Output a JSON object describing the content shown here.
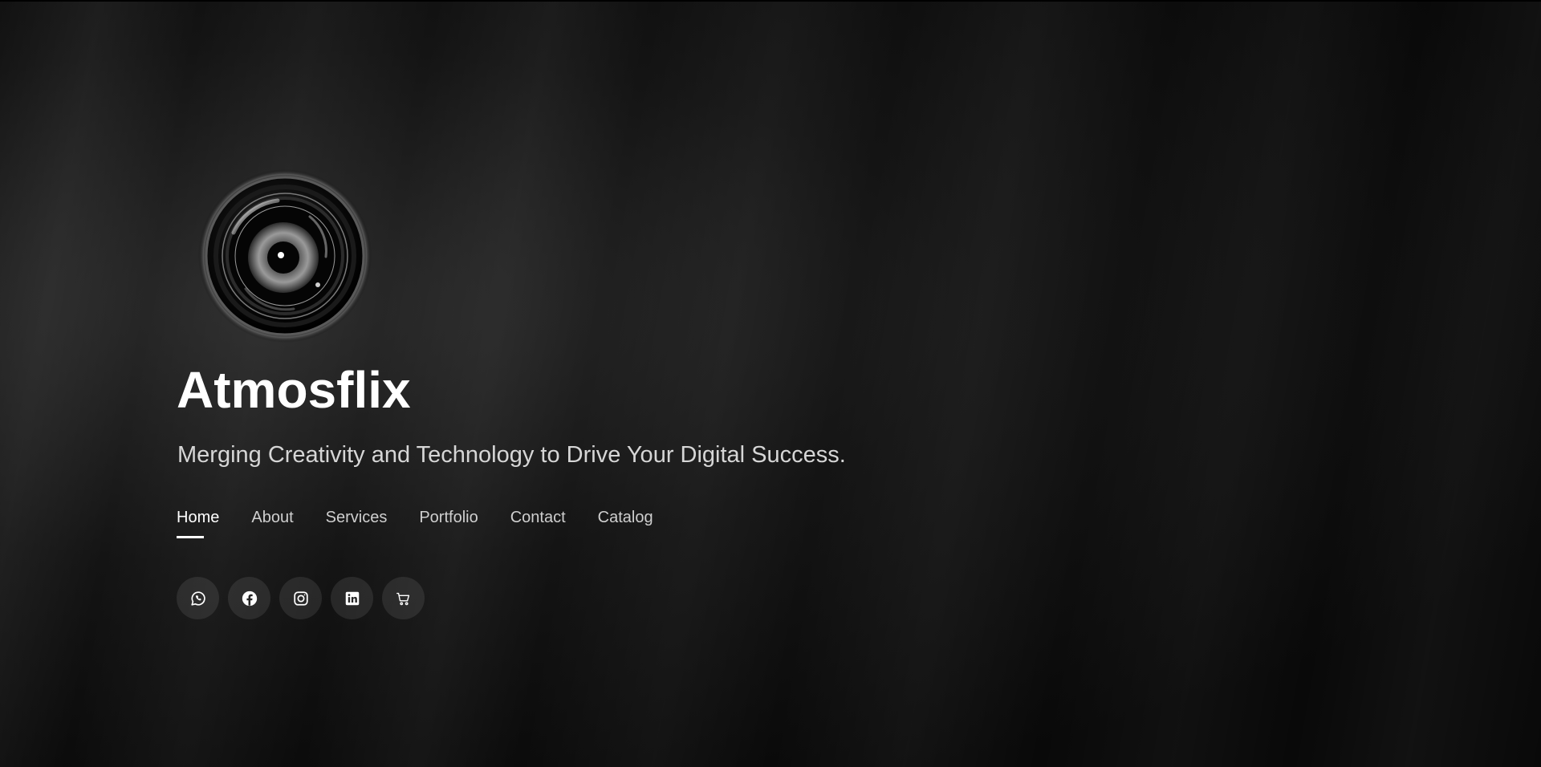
{
  "site": {
    "title": "Atmosflix",
    "tagline": "Merging Creativity and Technology to Drive Your Digital Success."
  },
  "nav": {
    "items": [
      {
        "label": "Home",
        "active": true
      },
      {
        "label": "About",
        "active": false
      },
      {
        "label": "Services",
        "active": false
      },
      {
        "label": "Portfolio",
        "active": false
      },
      {
        "label": "Contact",
        "active": false
      },
      {
        "label": "Catalog",
        "active": false
      }
    ]
  },
  "social": {
    "icons": [
      "whatsapp-icon",
      "facebook-icon",
      "instagram-icon",
      "linkedin-icon",
      "cart-icon"
    ]
  },
  "colors": {
    "background": "#0b0b0b",
    "text": "#ffffff",
    "muted_text": "#cfcfcf"
  }
}
